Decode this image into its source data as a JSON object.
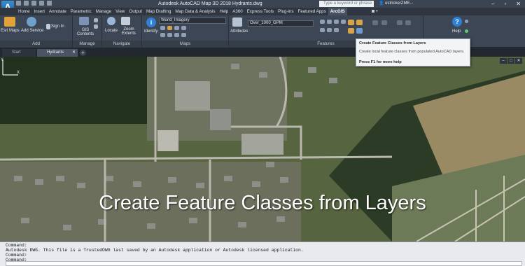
{
  "title_bar": {
    "app_logo": "A",
    "title": "Autodesk AutoCAD Map 3D 2018   Hydrants.dwg",
    "search_placeholder": "Type a keyword or phrase",
    "user": "estrickerZME...",
    "window_buttons": [
      "–",
      "▫",
      "✕"
    ]
  },
  "menu": {
    "tabs": [
      "Home",
      "Insert",
      "Annotate",
      "Parametric",
      "Manage",
      "View",
      "Output",
      "Map Drafting",
      "Map Data & Analysis",
      "Help",
      "A360",
      "Express Tools",
      "Plug-ins",
      "Featured Apps",
      "ArcGIS"
    ],
    "active_tab": "ArcGIS",
    "extra": "◙ •"
  },
  "ribbon": {
    "panels": {
      "add": "Add",
      "manage": "Manage",
      "navigate": "Navigate",
      "maps": "Maps",
      "features": "Features"
    },
    "buttons": {
      "esri_maps": "Esri Maps",
      "add_service": "Add Service",
      "sign_in": "Sign In",
      "gis_contents": "GIS Contents",
      "locate": "Locate",
      "zoom_extents": "Zoom Extents",
      "identify": "Identify",
      "attributes": "Attributes",
      "help": "Help"
    },
    "basemap_value": "World_Imagery",
    "layer_value": "Over_1000_GPM"
  },
  "tooltip": {
    "title": "Create Feature Classes from Layers",
    "description": "Create local feature classes from populated AutoCAD layers.",
    "help": "Press F1 for more help"
  },
  "doc_tabs": {
    "start": "Start",
    "active": "Hydrants",
    "add": "+"
  },
  "map": {
    "caption": "Create Feature Classes from Layers",
    "corner_controls": [
      "–",
      "□",
      "✕"
    ],
    "ucs_labels": {
      "x": "X",
      "y": "Y"
    }
  },
  "command_line": {
    "lines": [
      "Command:",
      "Autodesk DWG.  This file is a TrustedDWG last saved by an Autodesk application or Autodesk licensed application.",
      "Command:",
      "Command:"
    ]
  }
}
